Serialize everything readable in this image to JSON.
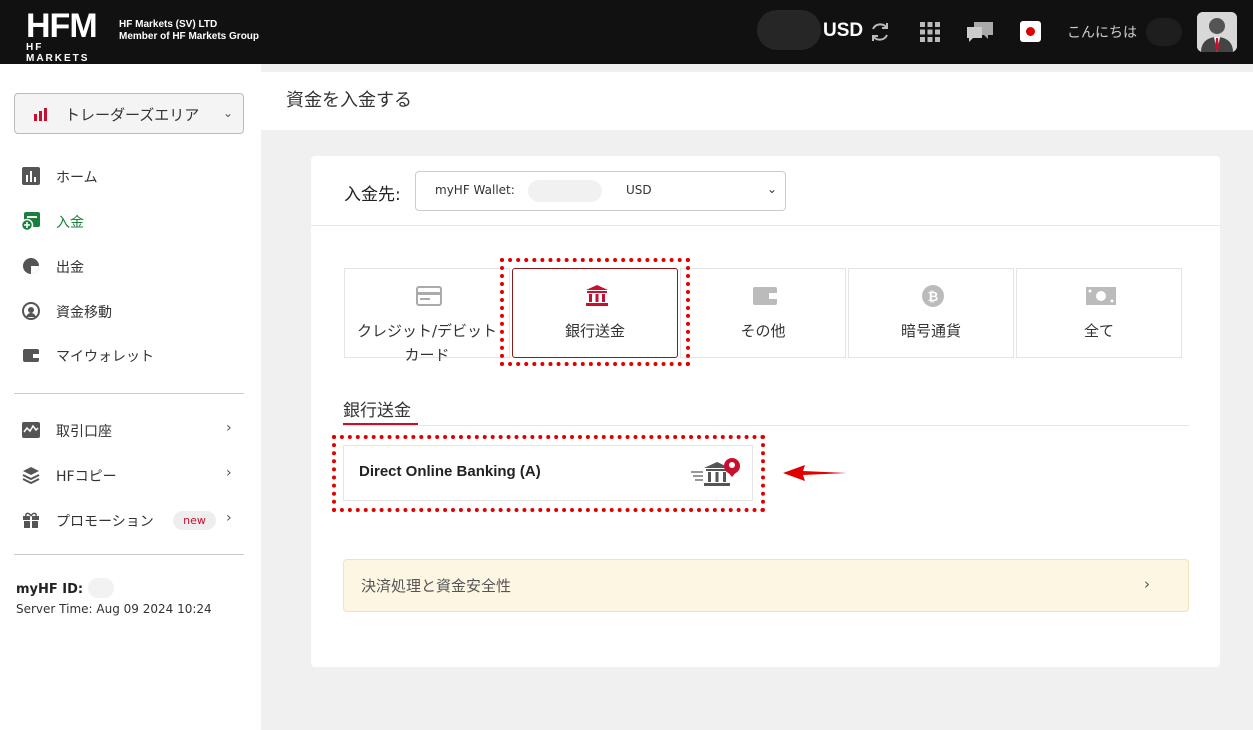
{
  "header": {
    "logo_main": "HFM",
    "logo_sub": "HF MARKETS",
    "company_line1": "HF Markets (SV) LTD",
    "company_line2": "Member of HF Markets Group",
    "currency": "USD",
    "greeting": "こんにちは",
    "icons": [
      "refresh-icon",
      "apps-grid-icon",
      "chat-icon",
      "japan-flag-icon",
      "avatar"
    ]
  },
  "sidebar": {
    "area_label": "トレーダーズエリア",
    "items": [
      {
        "label": "ホーム",
        "icon": "chart-icon",
        "active": false
      },
      {
        "label": "入金",
        "icon": "deposit-icon",
        "active": true
      },
      {
        "label": "出金",
        "icon": "withdraw-icon",
        "active": false
      },
      {
        "label": "資金移動",
        "icon": "transfer-icon",
        "active": false
      },
      {
        "label": "マイウォレット",
        "icon": "wallet-icon",
        "active": false
      },
      {
        "label": "取引口座",
        "icon": "trading-account-icon",
        "active": false
      },
      {
        "label": "HFコピー",
        "icon": "layers-icon",
        "active": false
      },
      {
        "label": "プロモーション",
        "icon": "gift-icon",
        "active": false
      }
    ],
    "badge_new": "new",
    "myhf_id_label": "myHF ID:",
    "server_time": "Server Time: Aug 09 2024 10:24"
  },
  "main": {
    "page_title": "資金を入金する",
    "dest_label": "入金先:",
    "wallet_label": "myHF Wallet:",
    "wallet_currency": "USD",
    "tiles": [
      {
        "label": "クレジット/デビットカード",
        "icon": "credit-card-icon"
      },
      {
        "label": "銀行送金",
        "icon": "bank-icon",
        "selected": true
      },
      {
        "label": "その他",
        "icon": "wallet-icon"
      },
      {
        "label": "暗号通貨",
        "icon": "bitcoin-icon"
      },
      {
        "label": "全て",
        "icon": "cash-icon"
      }
    ],
    "section_title": "銀行送金",
    "method_name": "Direct Online Banking (A)",
    "notice": "決済処理と資金安全性",
    "notice_chevron": "›"
  },
  "colors": {
    "brand_red": "#c8102e",
    "active_green": "#1a7f3c",
    "highlight_red": "#e10000",
    "notice_bg": "#fdf6e3"
  }
}
